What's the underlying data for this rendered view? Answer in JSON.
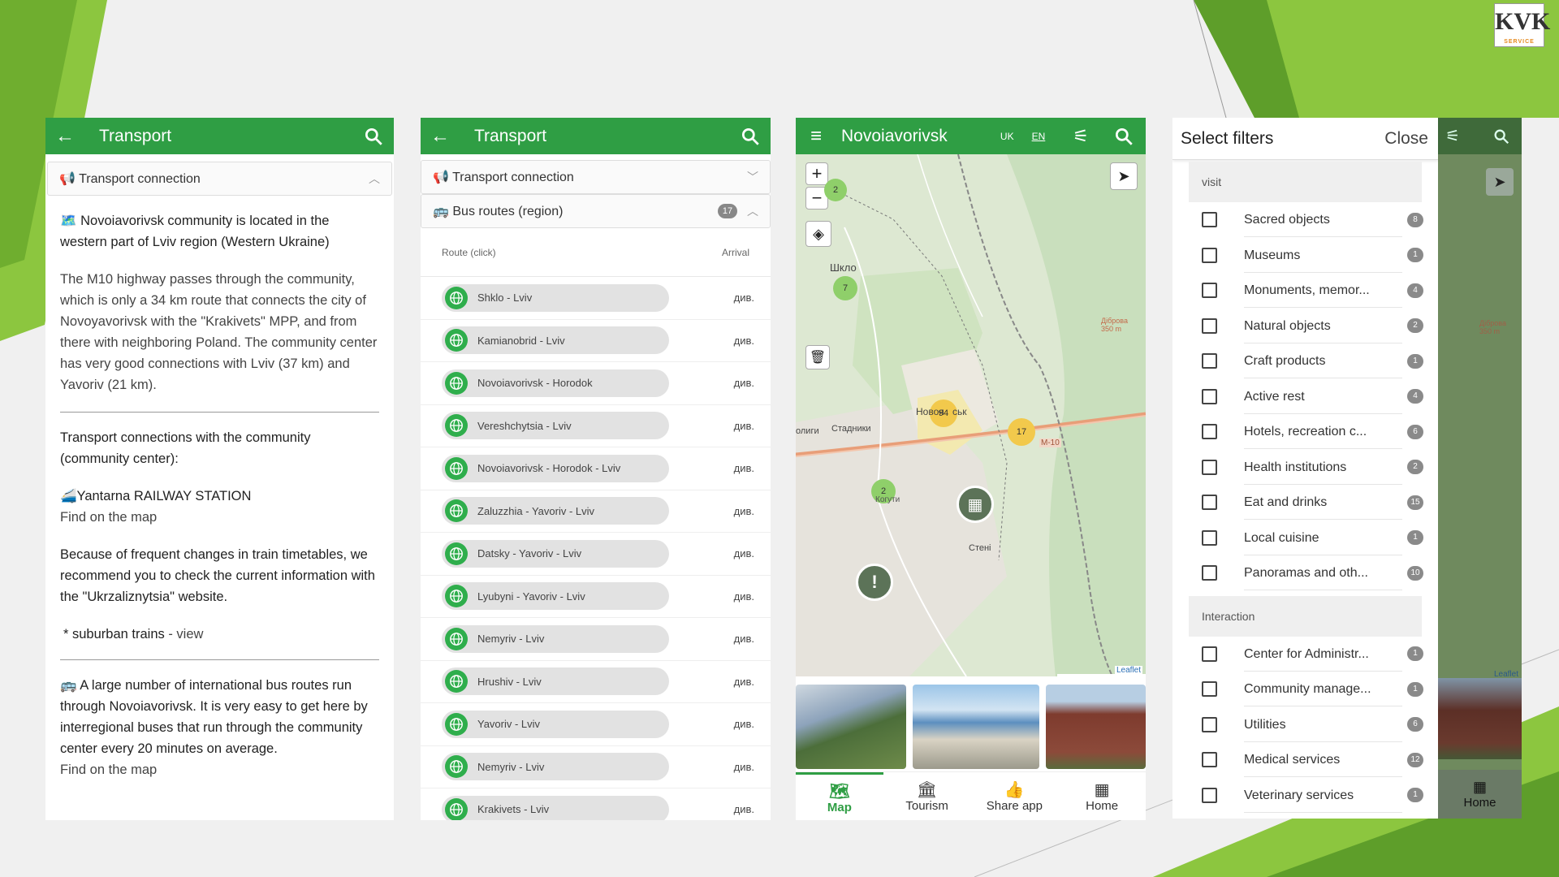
{
  "brand": {
    "logo_text": "KVK",
    "logo_sub": "SERVICE"
  },
  "screen1": {
    "title": "Transport",
    "accordion": "📢 Transport connection",
    "paragraphs": [
      "🗺️ Novoiavorivsk community is located in the western part of Lviv region (Western Ukraine)",
      "The M10 highway passes through the community, which is only a 34 km route that connects the city of Novoyavorivsk with the \"Krakivets\" MPP, and from there with neighboring Poland. The community center has very good connections with Lviv (37 km) and Yavoriv (21 km).",
      "Transport connections with the community (community center):",
      "🚄Yantarna RAILWAY STATION",
      "Find on the map",
      "Because of frequent changes in train timetables, we recommend you to check the current information with the \"Ukrzaliznytsia\" website.",
      " * suburban trains",
      " - view",
      "🚌 A large number of international bus routes run through Novoiavorivsk. It is very easy to get here by interregional buses that run through the community center every 20 minutes on average.",
      "Find on the map"
    ]
  },
  "screen2": {
    "title": "Transport",
    "acc1": "📢 Transport connection",
    "acc2": "🚌 Bus routes (region)",
    "acc2_count": "17",
    "col_route": "Route (click)",
    "col_arrival": "Arrival",
    "routes": [
      {
        "name": "Shklo - Lviv",
        "arrival": "див."
      },
      {
        "name": "Kamianobrid - Lviv",
        "arrival": "див."
      },
      {
        "name": "Novoiavorivsk - Horodok",
        "arrival": "див."
      },
      {
        "name": "Vereshchytsia - Lviv",
        "arrival": "див."
      },
      {
        "name": "Novoiavorivsk - Horodok - Lviv",
        "arrival": "див."
      },
      {
        "name": "Zaluzzhia - Yavoriv - Lviv",
        "arrival": "див."
      },
      {
        "name": "Datsky - Yavoriv - Lviv",
        "arrival": "див."
      },
      {
        "name": "Lyubyni - Yavoriv - Lviv",
        "arrival": "див."
      },
      {
        "name": "Nemyriv - Lviv",
        "arrival": "див."
      },
      {
        "name": "Hrushiv - Lviv",
        "arrival": "див."
      },
      {
        "name": "Yavoriv - Lviv",
        "arrival": "див."
      },
      {
        "name": "Nemyriv - Lviv",
        "arrival": "див."
      },
      {
        "name": "Krakivets - Lviv",
        "arrival": "див."
      }
    ]
  },
  "screen3": {
    "title": "Novoiavorivsk",
    "lang_uk": "UK",
    "lang_en": "EN",
    "zoom_in": "+",
    "zoom_out": "−",
    "clusters": [
      "2",
      "7",
      "94",
      "17",
      "2"
    ],
    "places": [
      "Шкло",
      "Новоя",
      "ськ",
      "Стадники",
      "олиги",
      "Когути",
      "Стені",
      "Діброва 350 m",
      "M-10"
    ],
    "attribution": "Leaflet",
    "nav": [
      "Map",
      "Tourism",
      "Share app",
      "Home"
    ]
  },
  "screen4": {
    "title": "Select filters",
    "close": "Close",
    "section1": "visit",
    "visit_items": [
      {
        "label": "Sacred objects",
        "count": "8"
      },
      {
        "label": "Museums",
        "count": "1"
      },
      {
        "label": "Monuments, memor...",
        "count": "4"
      },
      {
        "label": "Natural objects",
        "count": "2"
      },
      {
        "label": "Craft products",
        "count": "1"
      },
      {
        "label": "Active rest",
        "count": "4"
      },
      {
        "label": "Hotels, recreation c...",
        "count": "6"
      },
      {
        "label": "Health institutions",
        "count": "2"
      },
      {
        "label": "Eat and drinks",
        "count": "15"
      },
      {
        "label": "Local cuisine",
        "count": "1"
      },
      {
        "label": "Panoramas and oth...",
        "count": "10"
      }
    ],
    "section2": "Interaction",
    "interaction_items": [
      {
        "label": "Center for Administr...",
        "count": "1"
      },
      {
        "label": "Community manage...",
        "count": "1"
      },
      {
        "label": "Utilities",
        "count": "6"
      },
      {
        "label": "Medical services",
        "count": "12"
      },
      {
        "label": "Veterinary services",
        "count": "1"
      }
    ],
    "bg_nav_home": "Home",
    "bg_attribution": "Leaflet",
    "bg_place": "Діброва 350 m"
  },
  "colors": {
    "accent": "#2f9e44",
    "background_green": "#8cc63f"
  }
}
